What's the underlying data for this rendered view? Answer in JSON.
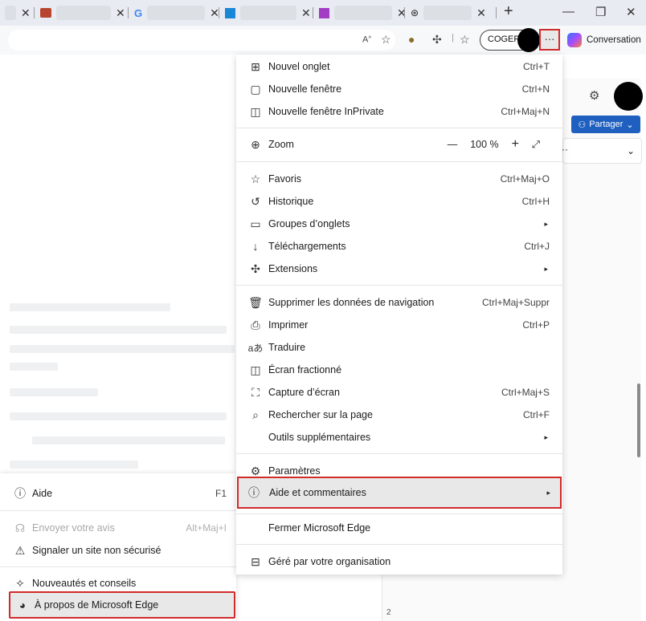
{
  "browser": {
    "tabs": [
      {
        "icon": "favicon-generic-icon"
      },
      {
        "icon": "briefcase-icon",
        "color": "#b8432f"
      },
      {
        "icon": "google-icon"
      },
      {
        "icon": "app-icon",
        "color": "#1a86d6"
      },
      {
        "icon": "app-icon",
        "color": "#a33cc4"
      },
      {
        "icon": "openai-icon"
      }
    ],
    "new_tab_label": "+",
    "window_controls": {
      "minimize": "—",
      "restore": "❐",
      "close": "✕"
    },
    "profile_label": "COGEP",
    "more_label": "···",
    "conversation_label": "Conversation",
    "share_label": "Partager",
    "page_number": "2",
    "colors": {
      "highlight_border": "#d12a2a",
      "share_bg": "#1f5fbf"
    }
  },
  "menu": {
    "sections": [
      [
        {
          "icon": "new-tab-icon",
          "label": "Nouvel onglet",
          "shortcut": "Ctrl+T"
        },
        {
          "icon": "new-window-icon",
          "label": "Nouvelle fenêtre",
          "shortcut": "Ctrl+N"
        },
        {
          "icon": "inprivate-icon",
          "label": "Nouvelle fenêtre InPrivate",
          "shortcut": "Ctrl+Maj+N"
        }
      ],
      [
        {
          "icon": "zoom-icon",
          "label": "Zoom",
          "zoom_minus": "—",
          "zoom_value": "100 %",
          "zoom_plus": "+",
          "zoom_expand": "⤢"
        }
      ],
      [
        {
          "icon": "favorites-icon",
          "label": "Favoris",
          "shortcut": "Ctrl+Maj+O"
        },
        {
          "icon": "history-icon",
          "label": "Historique",
          "shortcut": "Ctrl+H"
        },
        {
          "icon": "tab-groups-icon",
          "label": "Groupes d’onglets",
          "arrow": "▸"
        },
        {
          "icon": "download-icon",
          "label": "Téléchargements",
          "shortcut": "Ctrl+J"
        },
        {
          "icon": "extensions-icon",
          "label": "Extensions",
          "arrow": "▸"
        }
      ],
      [
        {
          "icon": "trash-icon",
          "label": "Supprimer les données de navigation",
          "shortcut": "Ctrl+Maj+Suppr"
        },
        {
          "icon": "print-icon",
          "label": "Imprimer",
          "shortcut": "Ctrl+P"
        },
        {
          "icon": "translate-icon",
          "label": "Traduire"
        },
        {
          "icon": "split-screen-icon",
          "label": "Écran fractionné"
        },
        {
          "icon": "screenshot-icon",
          "label": "Capture d’écran",
          "shortcut": "Ctrl+Maj+S"
        },
        {
          "icon": "find-icon",
          "label": "Rechercher sur la page",
          "shortcut": "Ctrl+F"
        },
        {
          "icon": "",
          "label": "Outils supplémentaires",
          "arrow": "▸"
        }
      ],
      [
        {
          "icon": "settings-icon",
          "label": "Paramètres"
        },
        {
          "icon": "help-icon",
          "label": "Aide et commentaires",
          "arrow": "▸"
        }
      ],
      [
        {
          "icon": "",
          "label": "Fermer Microsoft Edge"
        }
      ],
      [
        {
          "icon": "organization-icon",
          "label": "Géré par votre organisation"
        }
      ]
    ]
  },
  "submenu": {
    "items": [
      {
        "icon": "help-icon",
        "label": "Aide",
        "shortcut": "F1"
      },
      {
        "icon": "feedback-icon",
        "label": "Envoyer votre avis",
        "shortcut": "Alt+Maj+I",
        "disabled": true
      },
      {
        "icon": "warning-icon",
        "label": "Signaler un site non sécurisé"
      },
      {
        "icon": "whats-new-icon",
        "label": "Nouveautés et conseils"
      },
      {
        "icon": "edge-icon",
        "label": "À propos de Microsoft Edge"
      }
    ]
  }
}
